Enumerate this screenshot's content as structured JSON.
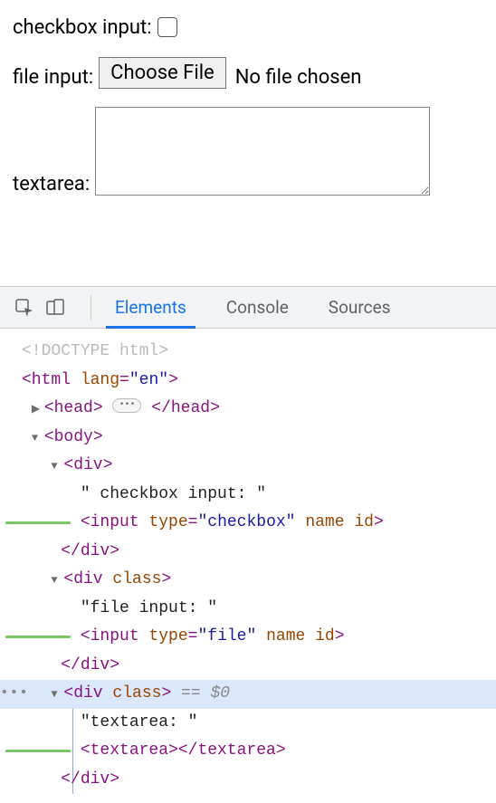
{
  "form": {
    "checkbox_label": "checkbox input: ",
    "file_label": "file input: ",
    "file_button": "Choose File",
    "file_status": "No file chosen",
    "textarea_label": "textarea: "
  },
  "devtools": {
    "tabs": {
      "elements": "Elements",
      "console": "Console",
      "sources": "Sources"
    },
    "dom": {
      "doctype": "<!DOCTYPE html>",
      "html_open": "<html ",
      "html_lang_attr": "lang",
      "html_lang_val": "\"en\"",
      "html_close_gt": ">",
      "head_open": "<head>",
      "head_close": "</head>",
      "body_open": "<body>",
      "div_open": "<div>",
      "div_close": "</div>",
      "div_class_open_a": "<div ",
      "div_class_attr": "class",
      "div_class_open_b": ">",
      "txt_checkbox": "\" checkbox input: \"",
      "txt_file": "\"file input: \"",
      "txt_textarea": "\"textarea: \"",
      "input_open": "<input ",
      "type_attr": "type",
      "type_checkbox_val": "\"checkbox\"",
      "type_file_val": "\"file\"",
      "name_attr": "name",
      "id_attr": "id",
      "input_close": ">",
      "textarea_open": "<textarea>",
      "textarea_close": "</textarea>",
      "sel_suffix": " == $0"
    }
  }
}
